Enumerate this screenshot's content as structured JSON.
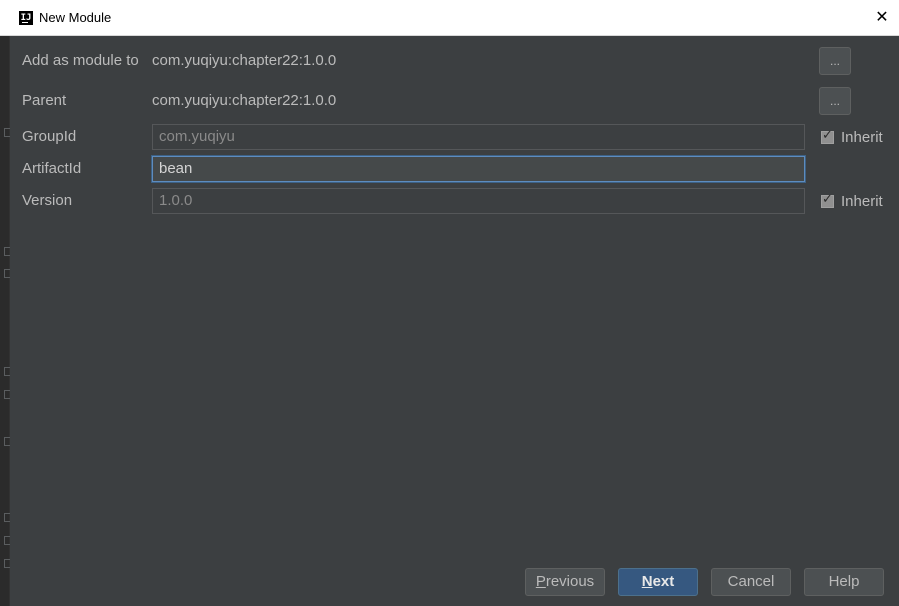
{
  "window": {
    "title": "New Module",
    "icon": "intellij-idea-icon",
    "close_glyph": "✕"
  },
  "form": {
    "add_as_module": {
      "label": "Add as module to",
      "value": "com.yuqiyu:chapter22:1.0.0",
      "button": "..."
    },
    "parent": {
      "label": "Parent",
      "value": "com.yuqiyu:chapter22:1.0.0",
      "button": "..."
    },
    "group_id": {
      "label": "GroupId",
      "value": "com.yuqiyu",
      "inherit_label": "Inherit",
      "inherit_checked": true
    },
    "artifact_id": {
      "label": "ArtifactId",
      "value": "bean"
    },
    "version": {
      "label": "Version",
      "value": "1.0.0",
      "inherit_label": "Inherit",
      "inherit_checked": true
    }
  },
  "buttons": {
    "previous": {
      "mnemonic": "P",
      "rest": "revious"
    },
    "next": {
      "mnemonic": "N",
      "rest": "ext"
    },
    "cancel": "Cancel",
    "help": "Help"
  },
  "colors": {
    "background": "#3c3f41",
    "primary_button": "#365880",
    "focus_border": "#5d8cbf"
  }
}
